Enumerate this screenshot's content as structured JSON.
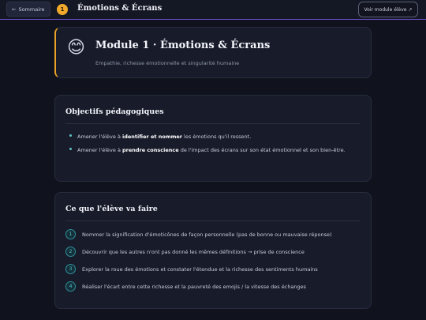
{
  "header": {
    "back_label": "Sommaire",
    "back_icon": "arrow-left-icon",
    "step_number": "1",
    "title": "Émotions & Écrans",
    "student_button_label": "Voir module élève",
    "student_button_icon": "external-link-icon",
    "accent_color": "#f0a92a"
  },
  "module": {
    "emoji": "😊",
    "title": "Module 1 · Émotions & Écrans",
    "subtitle": "Empathie, richesse émotionnelle et singularité humaine"
  },
  "objectives": {
    "title": "Objectifs pédagogiques",
    "items": [
      {
        "pre": "Amener l'élève à ",
        "bold": "identifier et nommer",
        "post": " les émotions qu'il ressent."
      },
      {
        "pre": "Amener l'élève à ",
        "bold": "prendre conscience",
        "post": " de l'impact des écrans sur son état émotionnel et son bien-être."
      }
    ]
  },
  "activities": {
    "title": "Ce que l'élève va faire",
    "items": [
      {
        "num": "1",
        "text": "Nommer la signification d'émoticônes de façon personnelle (pas de bonne ou mauvaise réponse)"
      },
      {
        "num": "2",
        "text": "Découvrir que les autres n'ont pas donné les mêmes définitions → prise de conscience"
      },
      {
        "num": "3",
        "text": "Explorer la roue des émotions et constater l'étendue et la richesse des sentiments humains"
      },
      {
        "num": "4",
        "text": "Réaliser l'écart entre cette richesse et la pauvreté des emojis / la vitesse des échanges"
      }
    ]
  }
}
